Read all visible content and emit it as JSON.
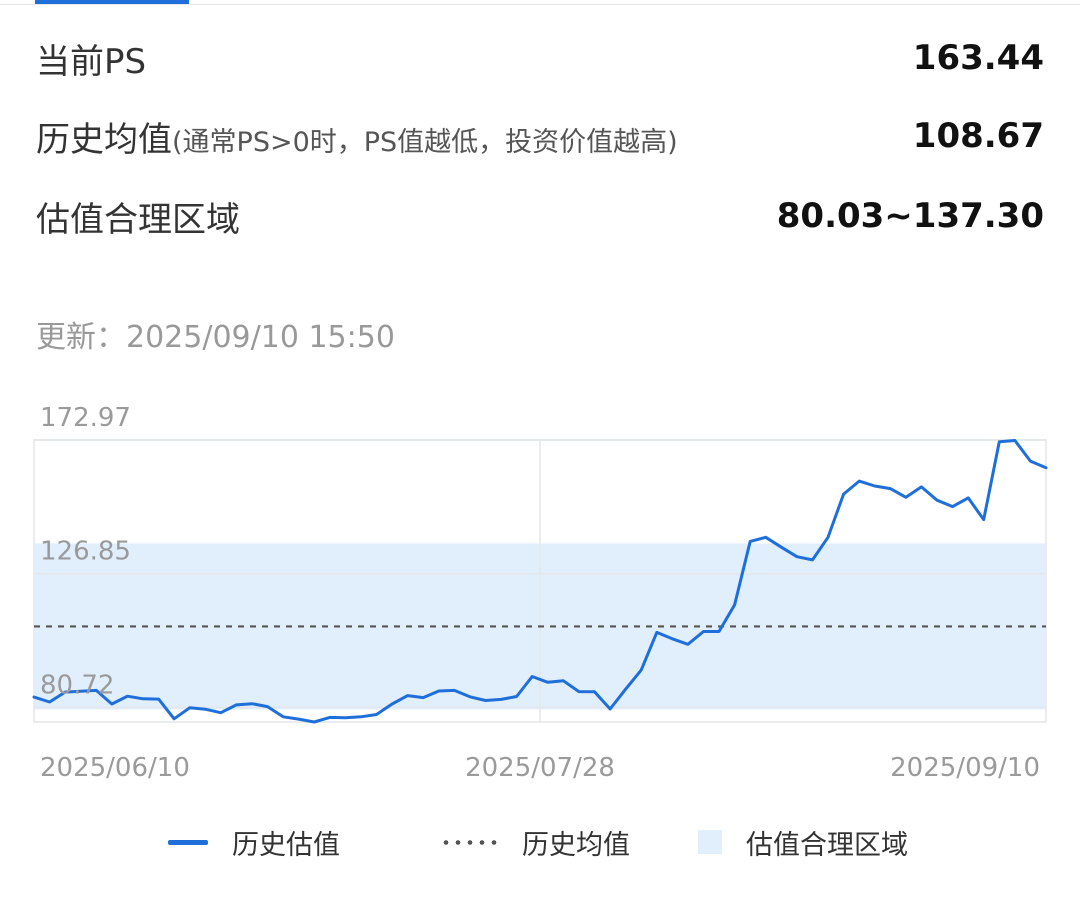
{
  "metrics": {
    "current_ps": {
      "label": "当前PS",
      "value": "163.44"
    },
    "hist_avg": {
      "label": "历史均值",
      "note": "(通常PS>0时，PS值越低，投资价值越高)",
      "value": "108.67"
    },
    "fair_range": {
      "label": "估值合理区域",
      "value": "80.03~137.30"
    }
  },
  "updated": "更新：2025/09/10 15:50",
  "colors": {
    "accent": "#1e6fd9",
    "band": "#e1eefc",
    "avg_line": "#555555",
    "grid": "#e3e6ea"
  },
  "chart_data": {
    "type": "line",
    "y_tick_labels": [
      "172.97",
      "126.85",
      "80.72"
    ],
    "y_ticks": [
      172.97,
      126.85,
      80.72
    ],
    "ylim": [
      75.7,
      172.97
    ],
    "x_tick_labels": [
      "2025/06/10",
      "2025/07/28",
      "2025/09/10"
    ],
    "grid": true,
    "band": [
      80.03,
      137.3
    ],
    "average": 108.67,
    "series": [
      {
        "name": "历史估值",
        "values": [
          84.3,
          82.6,
          86.0,
          86.3,
          86.6,
          81.9,
          84.6,
          83.7,
          83.6,
          76.8,
          80.6,
          80.1,
          78.9,
          81.6,
          82.0,
          81.0,
          77.5,
          76.7,
          75.7,
          77.3,
          77.2,
          77.5,
          78.3,
          81.9,
          84.8,
          84.1,
          86.4,
          86.6,
          84.4,
          83.1,
          83.5,
          84.5,
          91.4,
          89.4,
          89.9,
          86.2,
          86.1,
          80.2,
          87.0,
          93.6,
          106.6,
          104.4,
          102.5,
          106.9,
          106.9,
          116.1,
          138.0,
          139.4,
          136.0,
          132.7,
          131.6,
          139.4,
          154.3,
          158.8,
          157.1,
          156.2,
          153.2,
          156.8,
          152.2,
          150.0,
          153.0,
          145.5,
          172.4,
          172.8,
          165.7,
          163.4
        ]
      },
      {
        "name": "历史均值"
      },
      {
        "name": "估值合理区域"
      }
    ]
  }
}
